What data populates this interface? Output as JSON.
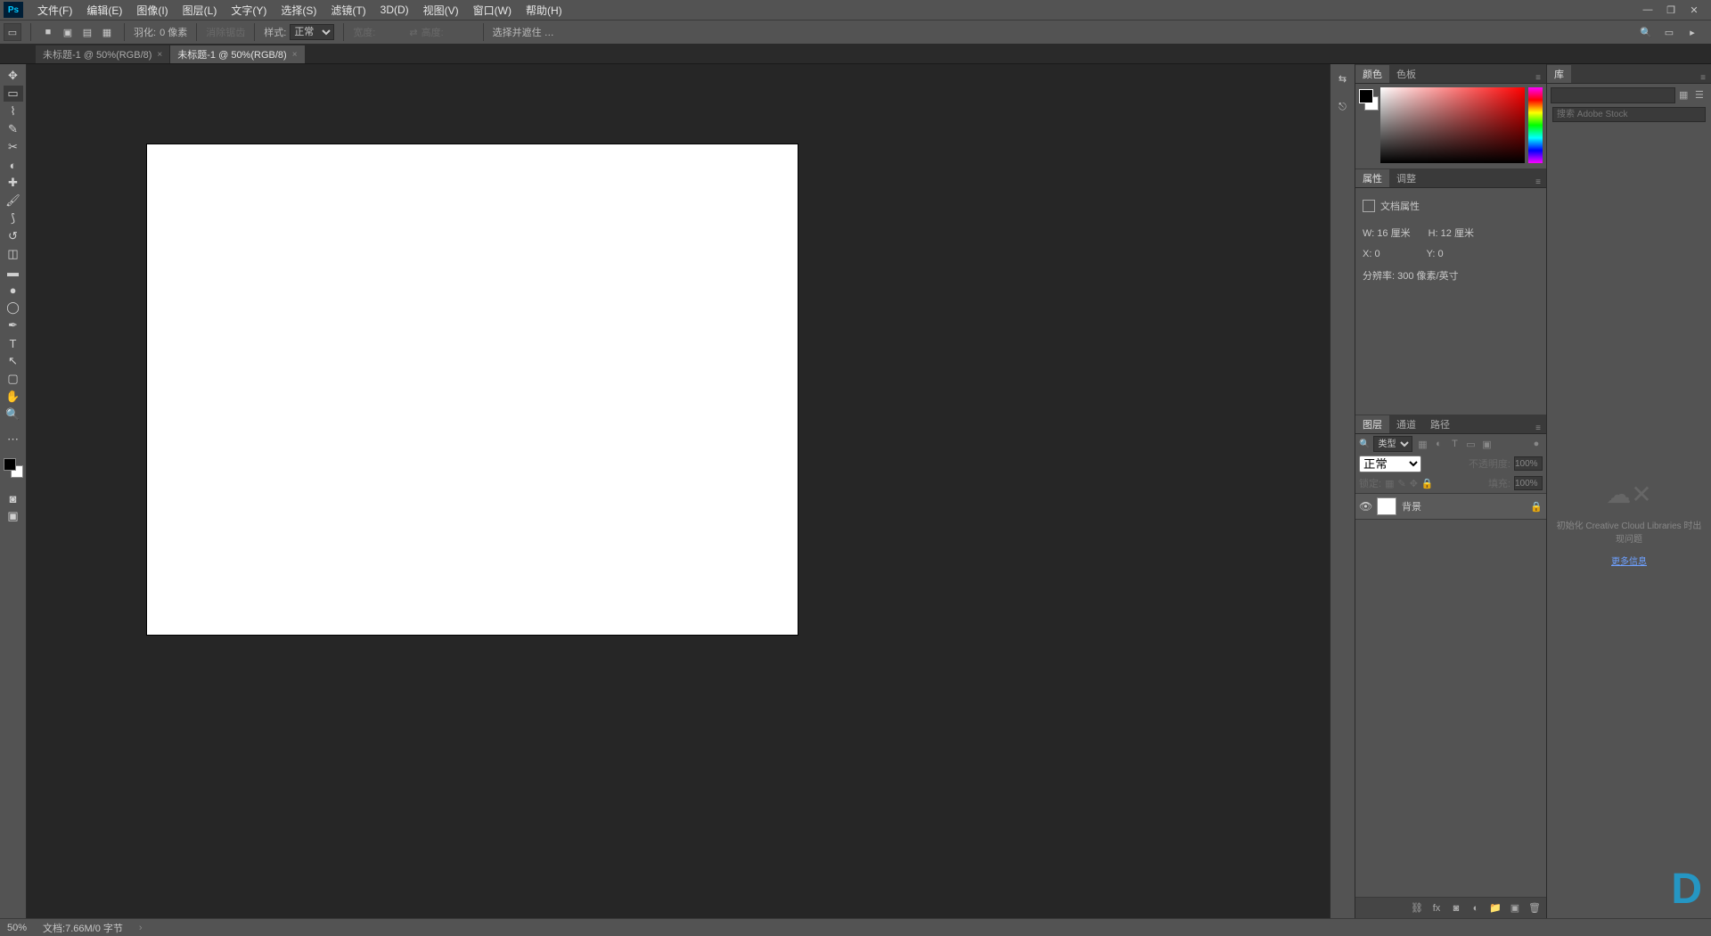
{
  "menubar": {
    "items": [
      "文件(F)",
      "编辑(E)",
      "图像(I)",
      "图层(L)",
      "文字(Y)",
      "选择(S)",
      "滤镜(T)",
      "3D(D)",
      "视图(V)",
      "窗口(W)",
      "帮助(H)"
    ]
  },
  "optbar": {
    "feather_label": "羽化:",
    "feather_value": "0 像素",
    "antialias": "消除锯齿",
    "style_label": "样式:",
    "style_value": "正常",
    "width_label": "宽度:",
    "height_label": "高度:",
    "refine": "选择并遮住 …"
  },
  "tabs": [
    {
      "label": "未标题-1 @ 50%(RGB/8)",
      "active": false
    },
    {
      "label": "未标题-1 @ 50%(RGB/8)",
      "active": true
    }
  ],
  "color_panel": {
    "tabs": [
      "颜色",
      "色板"
    ]
  },
  "prop_panel": {
    "tabs": [
      "属性",
      "调整"
    ],
    "title": "文档属性",
    "w_label": "W:",
    "w_value": "16 厘米",
    "h_label": "H:",
    "h_value": "12 厘米",
    "x_label": "X:",
    "x_value": "0",
    "y_label": "Y:",
    "y_value": "0",
    "res": "分辨率: 300 像素/英寸"
  },
  "layers_panel": {
    "tabs": [
      "图层",
      "通道",
      "路径"
    ],
    "kind_label": "类型",
    "blend": "正常",
    "opacity_label": "不透明度:",
    "opacity_value": "100%",
    "lock_label": "锁定:",
    "fill_label": "填充:",
    "fill_value": "100%",
    "layer_name": "背景"
  },
  "lib_panel": {
    "tab": "库",
    "search_placeholder": "搜索 Adobe Stock",
    "empty_text": "初始化 Creative Cloud Libraries 时出现问题",
    "more": "更多信息"
  },
  "status": {
    "zoom": "50%",
    "doc": "文档:7.66M/0 字节"
  }
}
